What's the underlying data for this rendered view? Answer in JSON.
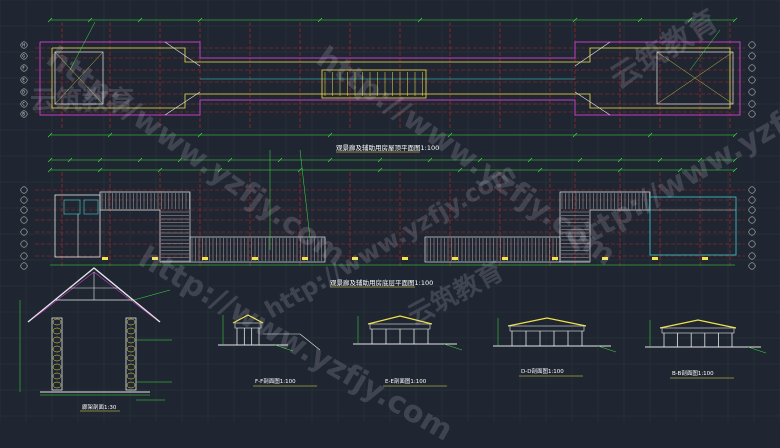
{
  "drawings": {
    "plan_title": "观景廊及辅助用房屋顶平面图1:100",
    "floor_title": "观景廊及辅助用房底层平面图1:100",
    "detail_title": "廊架剖面1:30",
    "sections": [
      {
        "label": "F-F剖面图1:100"
      },
      {
        "label": "E-E剖面图1:100"
      },
      {
        "label": "D-D剖面图1:100"
      },
      {
        "label": "B-B剖面图1:100"
      }
    ],
    "axis_letters": [
      "H",
      "G",
      "F",
      "E",
      "D",
      "C",
      "B",
      "A"
    ],
    "watermark_text": "http://www.yzfjy.com",
    "watermark_brand": "云筑教育"
  },
  "colors": {
    "background": "#1f2631",
    "grid": "#2c3440",
    "dim_green": "#3ce33c",
    "axis_red": "#d52a2a",
    "wall_magenta": "#c43fc4",
    "roof_yellow": "#f1e34a",
    "line_white": "#e6e6e6",
    "cyan": "#36d3d3"
  }
}
